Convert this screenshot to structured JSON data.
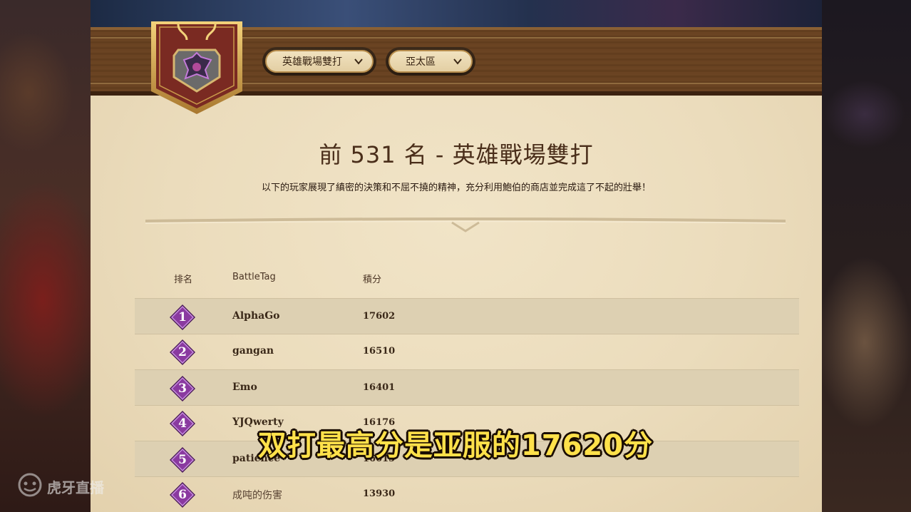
{
  "header": {
    "mode_dropdown": {
      "selected": "英雄戰場雙打"
    },
    "region_dropdown": {
      "selected": "亞太區"
    }
  },
  "title": "前 531 名 - 英雄戰場雙打",
  "subtitle": "以下的玩家展現了縝密的決策和不屈不撓的精神，充分利用鮑伯的商店並完成這了不起的壯舉！",
  "table": {
    "columns": [
      "排名",
      "BattleTag",
      "積分"
    ],
    "rows": [
      {
        "rank": "1",
        "battletag": "AlphaGo",
        "score": "17602"
      },
      {
        "rank": "2",
        "battletag": "gangan",
        "score": "16510"
      },
      {
        "rank": "3",
        "battletag": "Emo",
        "score": "16401"
      },
      {
        "rank": "4",
        "battletag": "YJQwerty",
        "score": "16176"
      },
      {
        "rank": "5",
        "battletag": "patience",
        "score": "16015"
      },
      {
        "rank": "6",
        "battletag": "成吨的伤害",
        "score": "13930"
      }
    ]
  },
  "caption": "双打最高分是亚服的17620分",
  "watermark": "虎牙直播",
  "colors": {
    "parchment": "#ebdcbc",
    "wood": "#6a4322",
    "rank_badge": "#7a2f8e",
    "caption_text": "#ffe14a"
  }
}
